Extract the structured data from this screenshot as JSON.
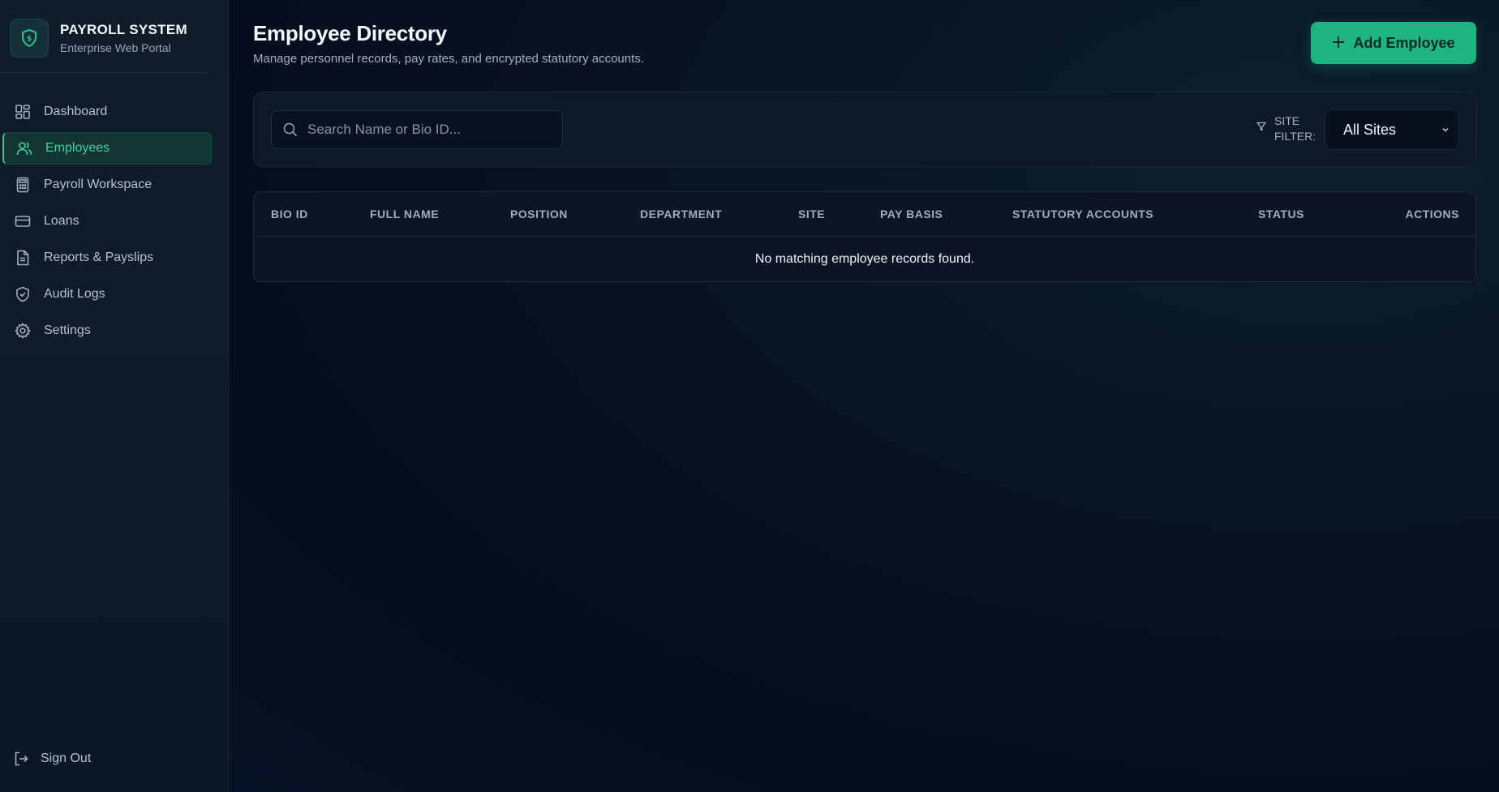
{
  "brand": {
    "title": "PAYROLL SYSTEM",
    "subtitle": "Enterprise Web Portal"
  },
  "sidebar": {
    "items": [
      {
        "label": "Dashboard",
        "icon": "dashboard-icon",
        "active": false
      },
      {
        "label": "Employees",
        "icon": "users-icon",
        "active": true
      },
      {
        "label": "Payroll Workspace",
        "icon": "calculator-icon",
        "active": false
      },
      {
        "label": "Loans",
        "icon": "credit-card-icon",
        "active": false
      },
      {
        "label": "Reports & Payslips",
        "icon": "file-report-icon",
        "active": false
      },
      {
        "label": "Audit Logs",
        "icon": "shield-check-icon",
        "active": false
      },
      {
        "label": "Settings",
        "icon": "gear-icon",
        "active": false
      }
    ],
    "sign_out": "Sign Out"
  },
  "header": {
    "title": "Employee Directory",
    "subtitle": "Manage personnel records, pay rates, and encrypted statutory accounts.",
    "add_button": "Add Employee"
  },
  "filters": {
    "search_placeholder": "Search Name or Bio ID...",
    "search_value": "",
    "site_filter_label": "SITE FILTER:",
    "site_selected": "All Sites"
  },
  "table": {
    "columns": [
      "BIO ID",
      "FULL NAME",
      "POSITION",
      "DEPARTMENT",
      "SITE",
      "PAY BASIS",
      "STATUTORY ACCOUNTS",
      "STATUS",
      "ACTIONS"
    ],
    "rows": [],
    "empty_message": "No matching employee records found."
  },
  "colors": {
    "accent": "#1eb483",
    "active_nav_text": "#3fd49d",
    "background": "#07101f"
  }
}
